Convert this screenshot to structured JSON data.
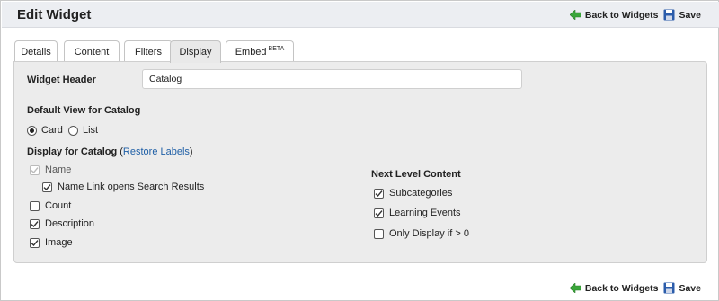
{
  "header": {
    "title": "Edit Widget"
  },
  "actions": {
    "back_label": "Back to Widgets",
    "save_label": "Save"
  },
  "tabs": [
    {
      "label": "Details",
      "sup": ""
    },
    {
      "label": "Content",
      "sup": ""
    },
    {
      "label": "Filters",
      "sup": ""
    },
    {
      "label": "Display",
      "sup": "",
      "active": true
    },
    {
      "label": "Embed",
      "sup": "BETA"
    }
  ],
  "form": {
    "widget_header_label": "Widget Header",
    "widget_header_value": "Catalog",
    "default_view_label": "Default View for Catalog",
    "view_options": [
      {
        "label": "Card",
        "selected": true
      },
      {
        "label": "List",
        "selected": false
      }
    ],
    "display_label": "Display for Catalog",
    "paren_open": "(",
    "restore_labels": "Restore Labels",
    "paren_close": ")",
    "display_items": [
      {
        "label": "Name",
        "checked": true,
        "disabled": true
      },
      {
        "label": "Name Link opens Search Results",
        "checked": true,
        "disabled": false
      },
      {
        "label": "Count",
        "checked": false,
        "disabled": false
      },
      {
        "label": "Description",
        "checked": true,
        "disabled": false
      },
      {
        "label": "Image",
        "checked": true,
        "disabled": false
      }
    ],
    "next_level_label": "Next Level Content",
    "next_level_items": [
      {
        "label": "Subcategories",
        "checked": true
      },
      {
        "label": "Learning Events",
        "checked": true
      },
      {
        "label": "Only Display if > 0",
        "checked": false
      }
    ]
  },
  "colors": {
    "link": "#1f5fa6",
    "back_arrow": "#3aa63a",
    "save_icon": "#2b5cab",
    "header_bg": "#eceef2",
    "panel_bg": "#ececec"
  },
  "icons": {
    "back": "green-left-arrow-icon",
    "save": "floppy-disk-icon",
    "check": "checkmark-icon"
  }
}
